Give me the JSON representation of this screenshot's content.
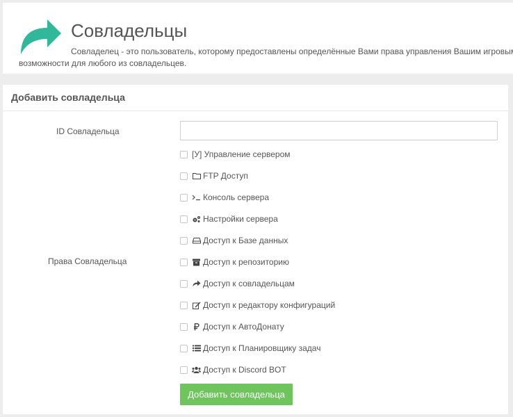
{
  "header": {
    "title": "Совладельцы",
    "description_line1": "Совладелец - это пользователь, которому предоставлены определённые Вами права управления Вашим игровым",
    "description_line2": "возможности для любого из совладельцев.",
    "icon": "share-arrow-icon",
    "icon_color": "#2fb99a"
  },
  "form": {
    "heading": "Добавить совладельца",
    "id_label": "ID Совладельца",
    "id_value": "",
    "rights_label": "Права Совладельца",
    "permissions": [
      {
        "label": "[У] Управление сервером",
        "icon": "",
        "checked": false
      },
      {
        "label": "FTP Доступ",
        "icon": "folder-icon",
        "checked": false
      },
      {
        "label": "Консоль сервера",
        "icon": "terminal-icon",
        "checked": false
      },
      {
        "label": "Настройки сервера",
        "icon": "gears-icon",
        "checked": false
      },
      {
        "label": "Доступ к Базе данных",
        "icon": "hdd-icon",
        "checked": false
      },
      {
        "label": "Доступ к репозиторию",
        "icon": "archive-icon",
        "checked": false
      },
      {
        "label": "Доступ к совладельцам",
        "icon": "share-icon",
        "checked": false
      },
      {
        "label": "Доступ к редактору конфигураций",
        "icon": "edit-icon",
        "checked": false
      },
      {
        "label": "Доступ к АвтоДонату",
        "icon": "ruble-icon",
        "checked": false
      },
      {
        "label": "Доступ к Планировщику задач",
        "icon": "list-icon",
        "checked": false
      },
      {
        "label": "Доступ к Discord BOT",
        "icon": "users-icon",
        "checked": false
      }
    ],
    "submit_label": "Добавить совладельца",
    "submit_color": "#6dc55c"
  }
}
